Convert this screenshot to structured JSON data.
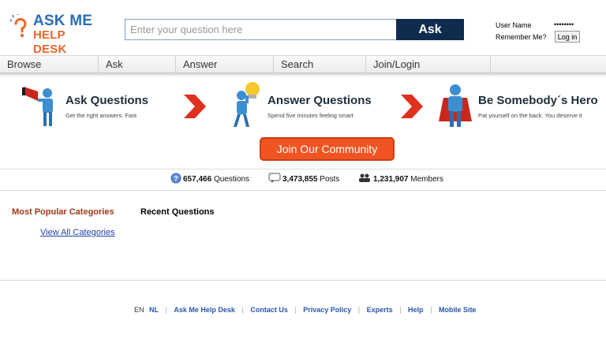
{
  "brand": {
    "line1": "ASK ME",
    "line2": "HELP DESK",
    "primary": "#2a6db6",
    "accent": "#e8672a"
  },
  "search": {
    "placeholder": "Enter your question here",
    "button": "Ask"
  },
  "login": {
    "user_label": "User Name",
    "password_value": "••••••••",
    "remember_label": "Remember Me?",
    "login_button": "Log in"
  },
  "nav": {
    "items": [
      "Browse",
      "Ask",
      "Answer",
      "Search",
      "Join/Login"
    ]
  },
  "features": [
    {
      "title": "Ask Questions",
      "subtitle": "Get the right answers. Fast"
    },
    {
      "title": "Answer Questions",
      "subtitle": "Spend five minutes feeling smart"
    },
    {
      "title": "Be Somebody´s Hero",
      "subtitle": "Pat yourself on the back. You deserve it"
    }
  ],
  "join": {
    "label": "Join Our Community",
    "color": "#f05423"
  },
  "stats": {
    "questions_count": "657,466",
    "questions_label": "Questions",
    "posts_count": "3,473,855",
    "posts_label": "Posts",
    "members_count": "1,231,907",
    "members_label": "Members"
  },
  "sections": {
    "most_popular": "Most Popular Categories",
    "recent": "Recent Questions",
    "view_all": "View All Categories"
  },
  "footer": {
    "lang_en": "EN",
    "lang_nl": "NL",
    "links": [
      "Ask Me Help Desk",
      "Contact Us",
      "Privacy Policy",
      "Experts",
      "Help",
      "Mobile Site"
    ]
  }
}
